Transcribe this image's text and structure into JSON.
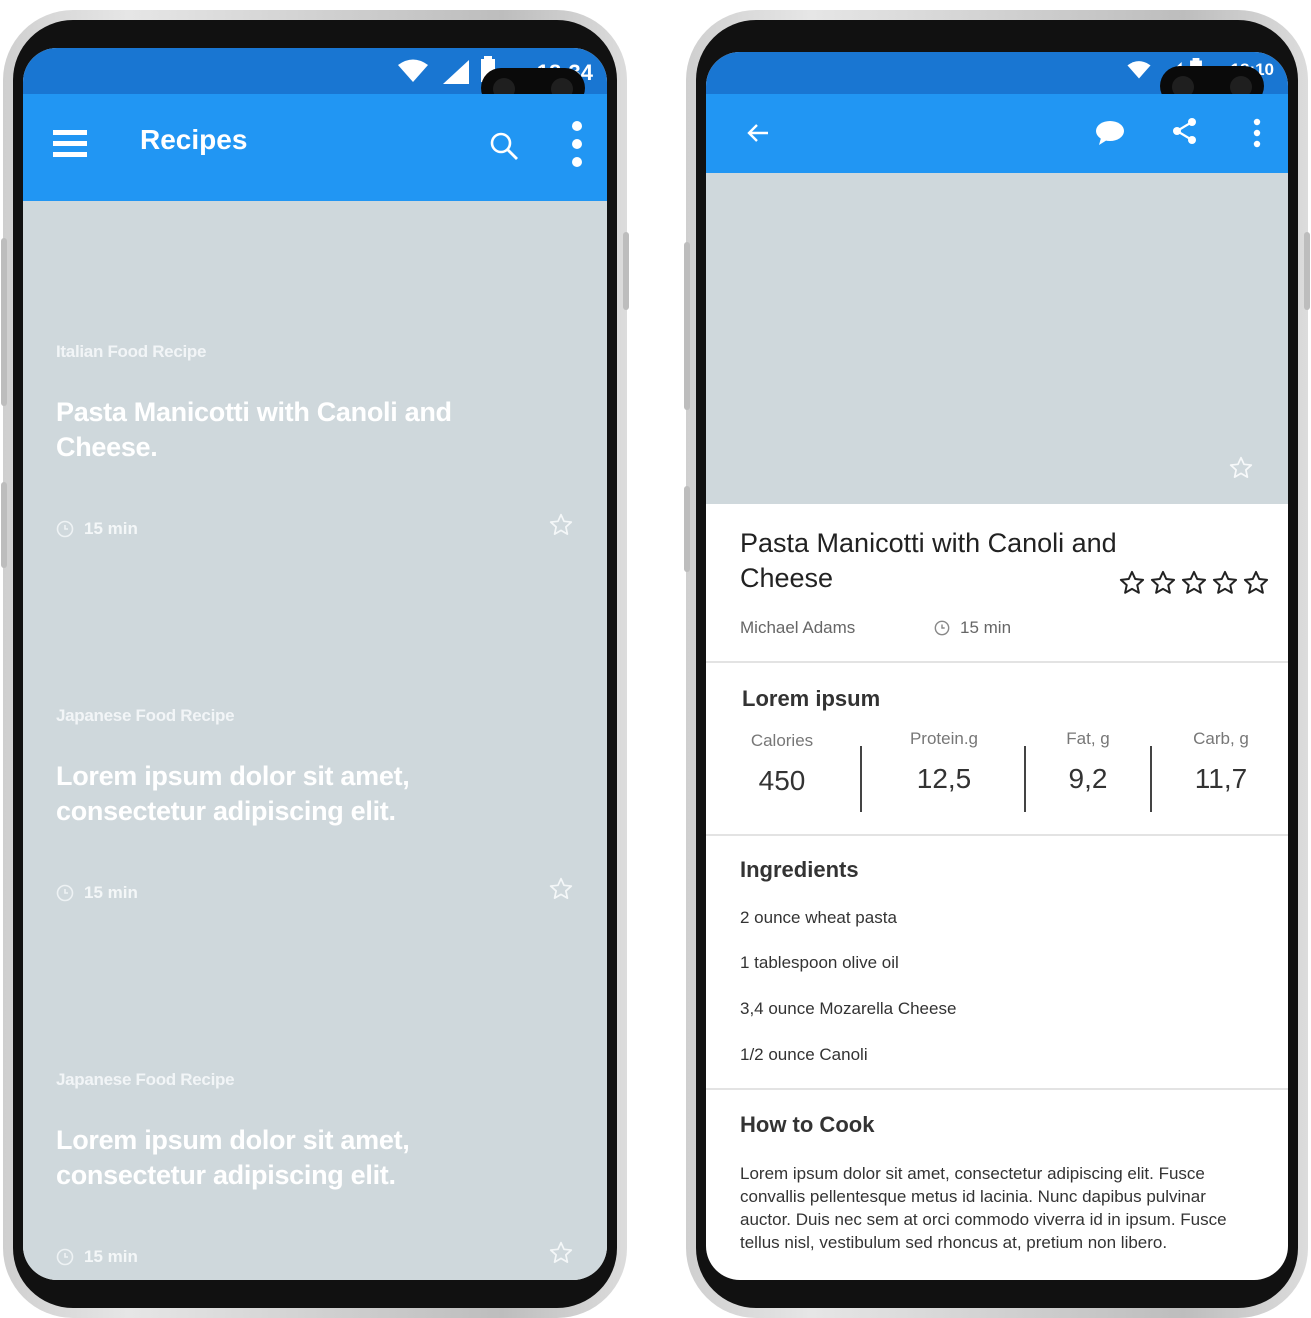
{
  "left_screen": {
    "status_time": "18:34",
    "appbar": {
      "title": "Recipes",
      "menu_icon": "menu-icon",
      "search_icon": "search-icon",
      "more_icon": "more-vert-icon"
    },
    "cards": [
      {
        "category": "Italian Food Recipe",
        "title": "Pasta Manicotti with Canoli and Cheese.",
        "time": "15 min"
      },
      {
        "category": "Japanese Food Recipe",
        "title": "Lorem ipsum dolor sit amet, consectetur adipiscing elit.",
        "time": "15 min"
      },
      {
        "category": "Japanese Food Recipe",
        "title": "Lorem ipsum dolor sit amet, consectetur adipiscing elit.",
        "time": "15 min"
      }
    ]
  },
  "right_screen": {
    "status_time": "18:10",
    "appbar": {
      "back_icon": "arrow-back-icon",
      "chat_icon": "chat-icon",
      "share_icon": "share-icon",
      "more_icon": "more-vert-icon"
    },
    "recipe": {
      "title": "Pasta Manicotti with Canoli and Cheese",
      "author": "Michael Adams",
      "time": "15 min",
      "rating": 0
    },
    "nutrition": {
      "heading": "Lorem ipsum",
      "items": [
        {
          "label": "Calories",
          "value": "450"
        },
        {
          "label": "Protein.g",
          "value": "12,5"
        },
        {
          "label": "Fat, g",
          "value": "9,2"
        },
        {
          "label": "Carb, g",
          "value": "11,7"
        }
      ]
    },
    "ingredients": {
      "heading": "Ingredients",
      "items": [
        "2 ounce wheat pasta",
        "1 tablespoon olive oil",
        "3,4 ounce Mozarella Cheese",
        "1/2 ounce Canoli"
      ]
    },
    "how_to_cook": {
      "heading": "How to Cook",
      "text": "Lorem ipsum dolor sit amet, consectetur adipiscing elit. Fusce convallis pellentesque metus id lacinia. Nunc dapibus pulvinar auctor. Duis nec sem at orci commodo viverra id in ipsum. Fusce tellus nisl, vestibulum sed rhoncus at, pretium non libero."
    }
  },
  "colors": {
    "primary": "#2196f3",
    "status_bar": "#1976d2",
    "placeholder": "#cfd8dc"
  }
}
